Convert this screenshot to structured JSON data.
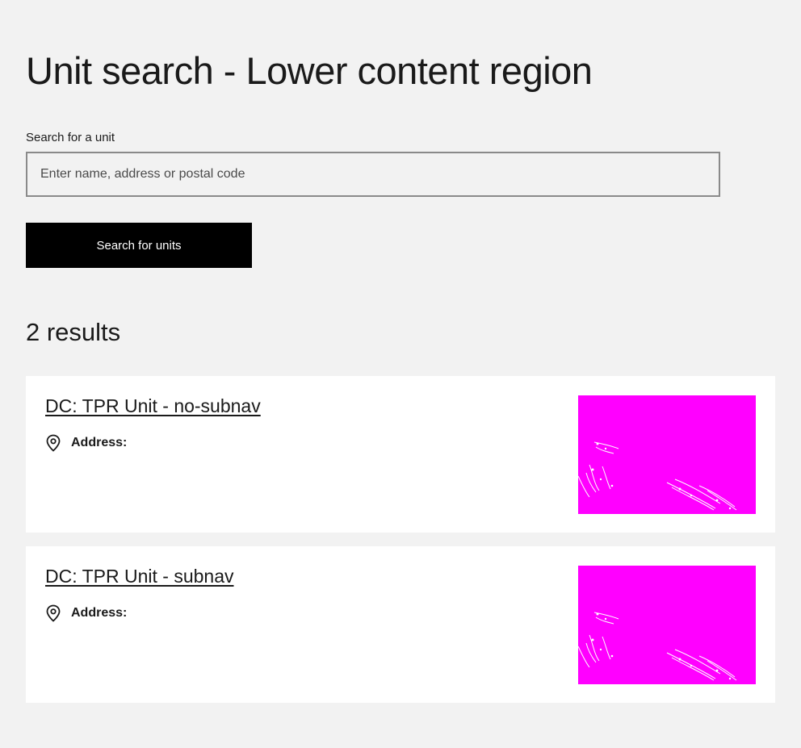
{
  "page": {
    "title": "Unit search - Lower content region"
  },
  "search": {
    "label": "Search for a unit",
    "placeholder": "Enter name, address or postal code",
    "value": "",
    "button_label": "Search for units"
  },
  "results": {
    "count_label": "2 results",
    "items": [
      {
        "title": "DC: TPR Unit - no-subnav",
        "address_label": "Address:",
        "icon": "location-pin-icon",
        "thumbnail_color": "#ff00ff"
      },
      {
        "title": "DC: TPR Unit - subnav",
        "address_label": "Address:",
        "icon": "location-pin-icon",
        "thumbnail_color": "#ff00ff"
      }
    ]
  },
  "colors": {
    "background": "#f2f2f2",
    "card": "#ffffff",
    "button": "#000000",
    "button_text": "#ffffff",
    "placeholder_image": "#ff00ff"
  }
}
